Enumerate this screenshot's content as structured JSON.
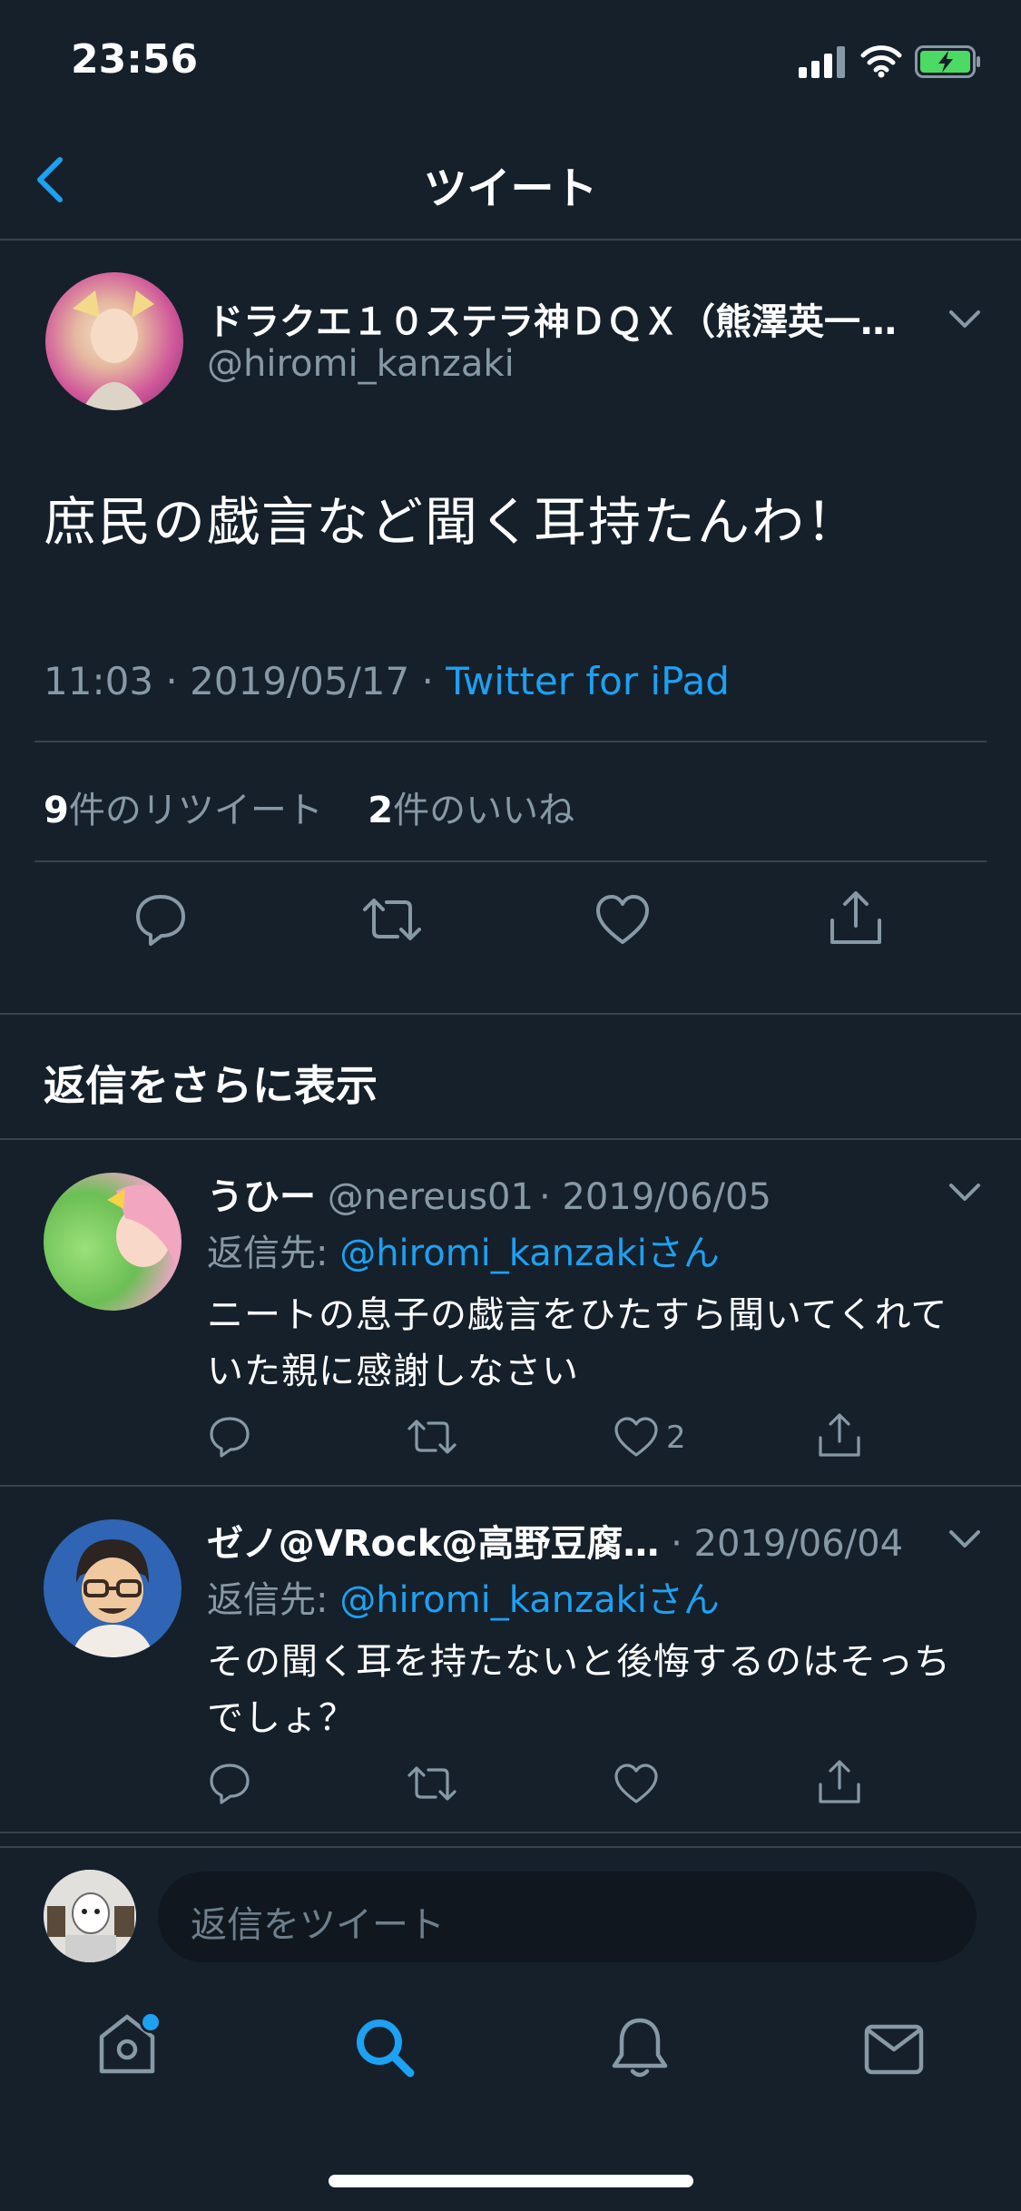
{
  "status_bar": {
    "time": "23:56"
  },
  "header": {
    "title": "ツイート"
  },
  "tweet": {
    "display_name": "ドラクエ１０ステラ神ＤＱＸ（熊澤英一…",
    "handle": "@hiromi_kanzaki",
    "text": "庶民の戯言など聞く耳持たんわ！",
    "time_date": "11:03 · 2019/05/17 · ",
    "source": "Twitter for iPad",
    "retweet_count": "9",
    "retweet_label": "件のリツイート",
    "like_count": "2",
    "like_label": "件のいいね"
  },
  "more_replies": {
    "label": "返信をさらに表示"
  },
  "replies": [
    {
      "name": "うひー",
      "handle": "@nereus01",
      "date": "· 2019/06/05",
      "reply_prefix": "返信先: ",
      "reply_to": "@hiromi_kanzakiさん",
      "text": "ニートの息子の戯言をひたすら聞いてくれていた親に感謝しなさい",
      "like_count": "2"
    },
    {
      "name": "ゼノ@VRock@高野豆腐…",
      "handle": "",
      "date": "· 2019/06/04",
      "reply_prefix": "返信先: ",
      "reply_to": "@hiromi_kanzakiさん",
      "text": "その聞く耳を持たないと後悔するのはそっちでしょ？",
      "like_count": ""
    }
  ],
  "compose": {
    "placeholder": "返信をツイート"
  },
  "colors": {
    "background": "#15202b",
    "accent": "#1da1f2",
    "secondary": "#8899a6",
    "divider": "#38444d"
  },
  "tab_bar": {
    "items": [
      {
        "icon": "home-icon",
        "active": false,
        "badge": true
      },
      {
        "icon": "search-icon",
        "active": true
      },
      {
        "icon": "bell-icon",
        "active": false
      },
      {
        "icon": "mail-icon",
        "active": false
      }
    ]
  }
}
